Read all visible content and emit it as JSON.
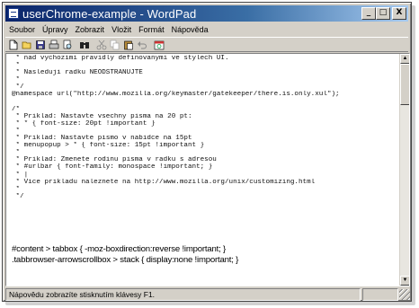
{
  "window": {
    "title": "userChrome-example - WordPad",
    "minimize_glyph": "_",
    "maximize_glyph": "□",
    "close_glyph": "X"
  },
  "menubar": {
    "items": [
      "Soubor",
      "Úpravy",
      "Zobrazit",
      "Vložit",
      "Formát",
      "Nápověda"
    ]
  },
  "toolbar": {
    "buttons": [
      "new-icon",
      "open-icon",
      "save-icon",
      "print-icon",
      "print-preview-icon",
      "find-icon",
      "cut-icon",
      "copy-icon",
      "paste-icon",
      "undo-icon",
      "date-time-icon"
    ]
  },
  "document": {
    "lines": [
      " * nad vychozimi pravidly definovanymi ve stylech UI.",
      " *",
      " * Nasleduji radku NEODSTRANUJTE",
      " *",
      " */",
      "@namespace url(\"http://www.mozilla.org/keymaster/gatekeeper/there.is.only.xul\");",
      "",
      "/*",
      " * Priklad: Nastavte vsechny pisma na 20 pt:",
      " * * { font-size: 20pt !important }",
      " *",
      " * Priklad: Nastavte pismo v nabidce na 15pt",
      " * menupopup > * { font-size: 15pt !important }",
      " *",
      " * Priklad: Zmenete rodinu pisma v radku s adresou",
      " * #urlbar { font-family: monospace !important; }",
      " * |",
      " * Vice prikladu naleznete na http://www.mozilla.org/unix/customizing.html",
      " *",
      " */"
    ],
    "css_lines": [
      "#content > tabbox { -moz-boxdirection:reverse !important; }",
      ".tabbrowser-arrowscrollbox > stack { display:none !important; }"
    ]
  },
  "status": {
    "text": "Nápovědu zobrazíte stisknutím klávesy F1."
  },
  "colors": {
    "titlebar_start": "#0a246a",
    "titlebar_end": "#a6caf0",
    "chrome": "#d4d0c8"
  }
}
